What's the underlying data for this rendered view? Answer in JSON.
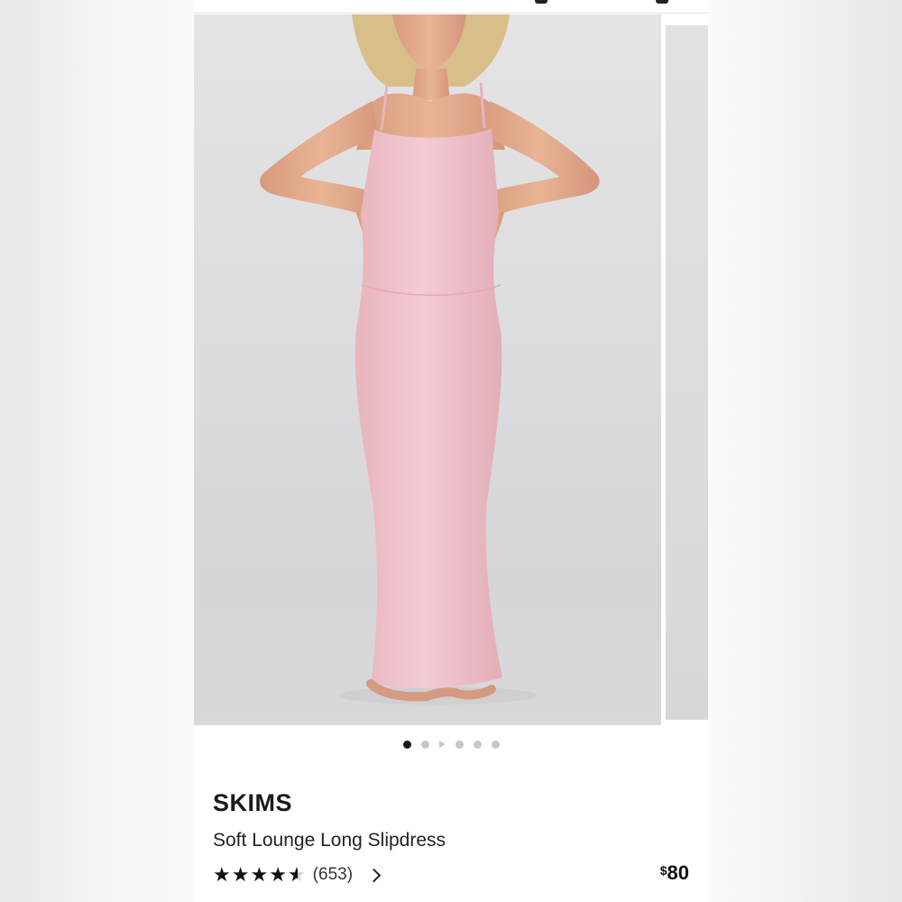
{
  "product": {
    "brand": "SKIMS",
    "name": "Soft Lounge Long Slipdress",
    "rating_value": 4.5,
    "review_count": "(653)",
    "price_currency": "$",
    "price_amount": "80"
  },
  "gallery": {
    "slide_count": 6,
    "active_index": 0,
    "dress_color": "#f1c6cf",
    "skin_color": "#e3a98a"
  },
  "icons": [
    "star-icon",
    "chevron-right-icon",
    "play-icon"
  ]
}
